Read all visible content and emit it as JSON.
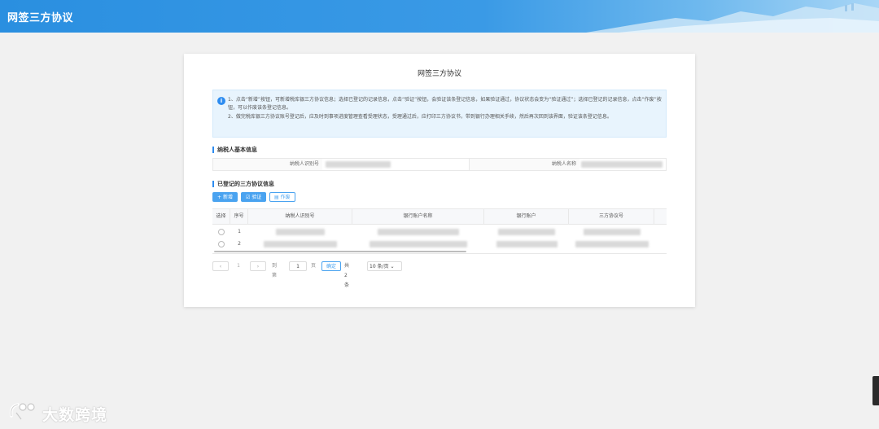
{
  "app": {
    "title": "网签三方协议"
  },
  "page": {
    "title": "网签三方协议"
  },
  "notice": {
    "line1": "1、点击“新增”按钮，可新增税库银三方协议信息；选择已登记的记录信息，点击“验证”按钮，会验证该条登记信息，如果验证通过，协议状态会变为“验证通过”；选择已登记的记录信息，点击“作废”按钮，可以作废该条登记信息。",
    "line2": "2、做完税库银三方协议账号登记后，应及时到事项进度管理查看受理状态，受理通过后，应打印三方协议书，带到银行办理相关手续，然后再次回到该界面，验证该条登记信息。"
  },
  "taxpayer_section": {
    "title": "纳税人基本信息",
    "id_label": "纳税人识别号",
    "name_label": "纳税人名称"
  },
  "agreements_section": {
    "title": "已登记的三方协议信息",
    "buttons": {
      "add": "新增",
      "verify": "验证",
      "void": "作废"
    }
  },
  "table": {
    "headers": [
      "选择",
      "序号",
      "纳税人识别号",
      "银行账户名称",
      "银行账户",
      "三方协议号"
    ],
    "rows": [
      {
        "index": "1"
      },
      {
        "index": "2"
      }
    ]
  },
  "pagination": {
    "current_page": "1",
    "goto_label": "到第",
    "goto_value": "1",
    "page_unit": "页",
    "confirm": "确定",
    "total": "共 2 条",
    "page_size": "10 条/页"
  },
  "watermark": {
    "text": "大数跨境"
  },
  "colors": {
    "primary": "#2d8cf0",
    "header_bg": "#2a8fe0",
    "notice_bg": "#e8f4fd"
  }
}
